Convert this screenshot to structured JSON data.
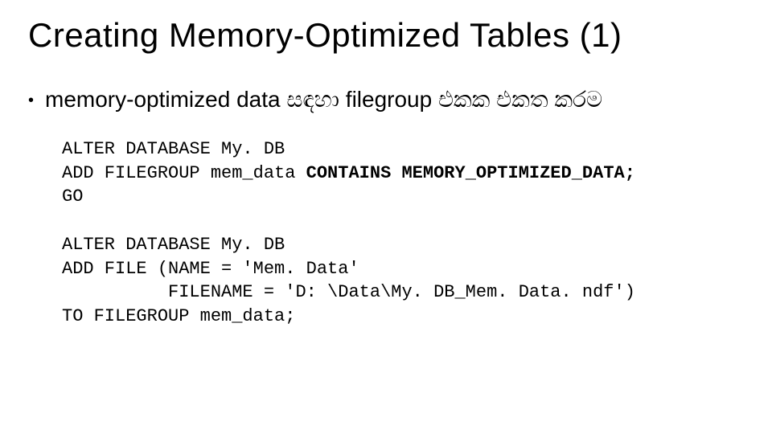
{
  "title": "Creating Memory-Optimized Tables (1)",
  "bullet": {
    "text": "memory-optimized data සඳහා  filegroup එකක   එකත   කරම"
  },
  "code": {
    "line1": "ALTER DATABASE My. DB",
    "line2a": "ADD FILEGROUP mem_data ",
    "line2b": "CONTAINS MEMORY_OPTIMIZED_DATA;",
    "line3": "GO",
    "line4": "ALTER DATABASE My. DB",
    "line5": "ADD FILE (NAME = 'Mem. Data'",
    "line6": "          FILENAME = 'D: \\Data\\My. DB_Mem. Data. ndf')",
    "line7": "TO FILEGROUP mem_data;"
  }
}
